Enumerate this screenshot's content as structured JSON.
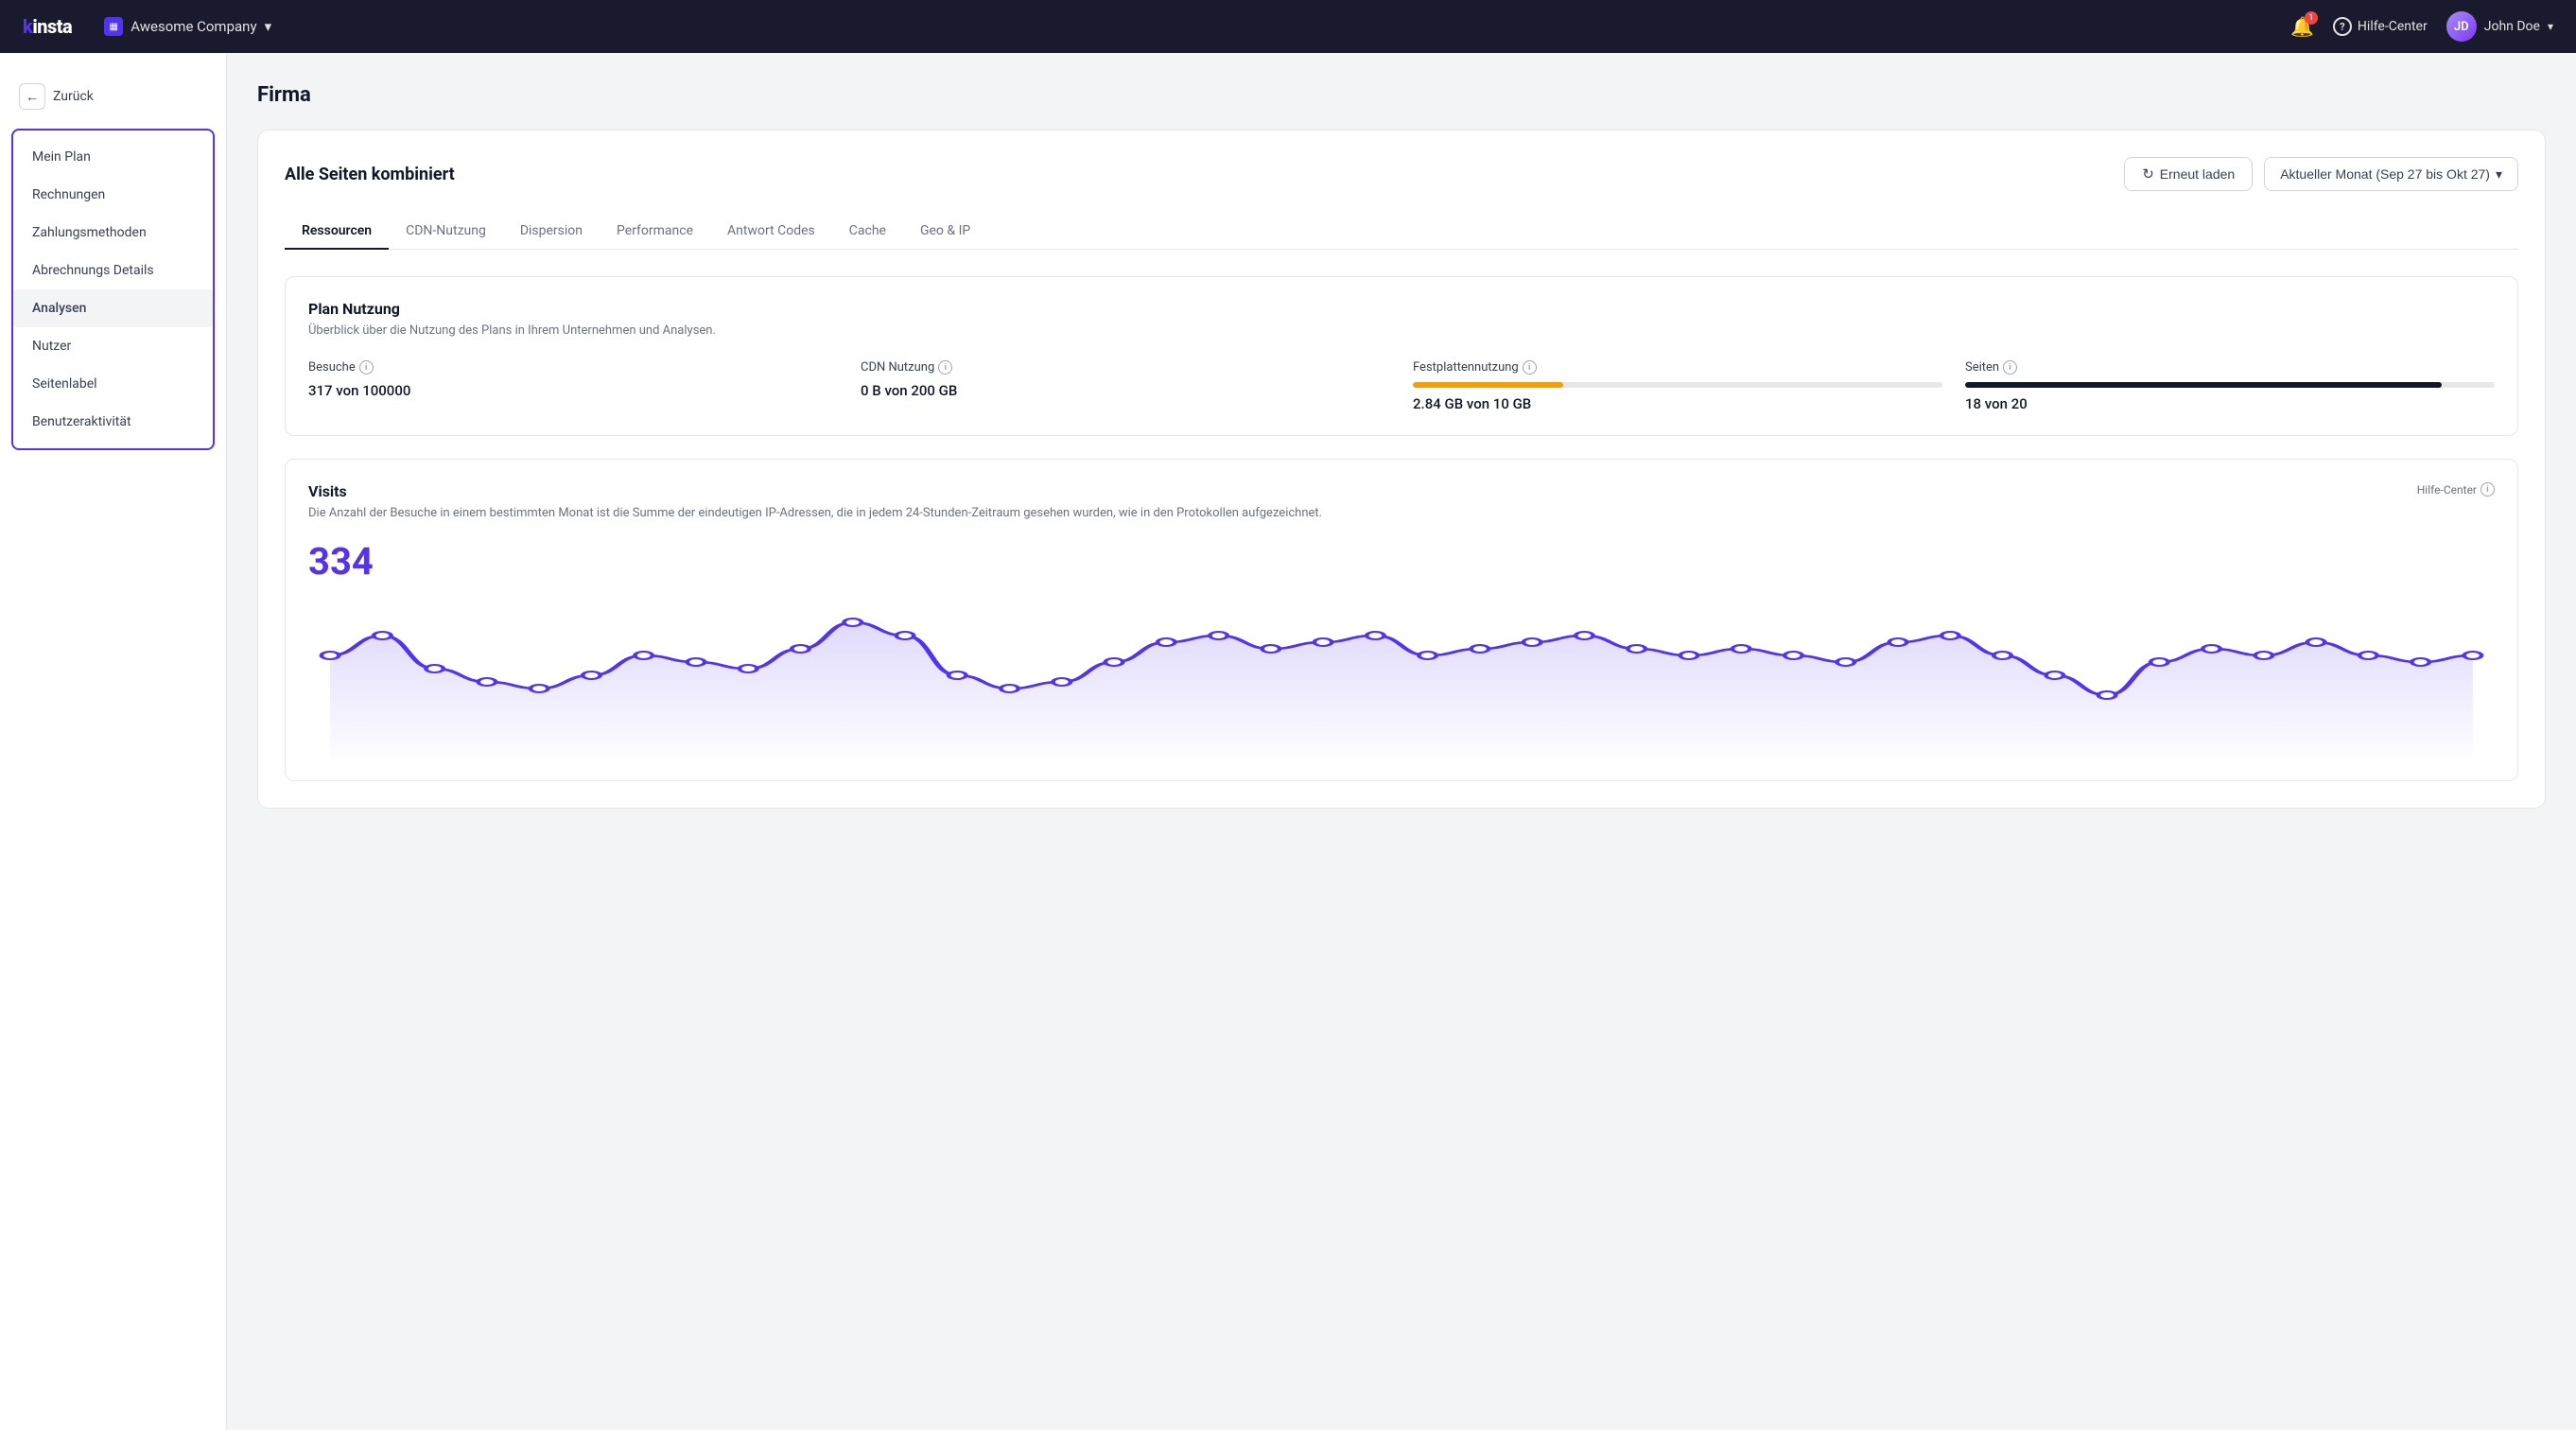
{
  "topnav": {
    "logo": "kinsta",
    "company": "Awesome Company",
    "company_icon": "▦",
    "bell_badge": "1",
    "help_label": "Hilfe-Center",
    "help_icon": "?",
    "username": "John Doe",
    "avatar_initials": "JD"
  },
  "sidebar": {
    "back_label": "Zurück",
    "items": [
      {
        "id": "mein-plan",
        "label": "Mein Plan",
        "active": false
      },
      {
        "id": "rechnungen",
        "label": "Rechnungen",
        "active": false
      },
      {
        "id": "zahlungsmethoden",
        "label": "Zahlungsmethoden",
        "active": false
      },
      {
        "id": "abrechnungs-details",
        "label": "Abrechnungs Details",
        "active": false
      },
      {
        "id": "analysen",
        "label": "Analysen",
        "active": true
      },
      {
        "id": "nutzer",
        "label": "Nutzer",
        "active": false
      },
      {
        "id": "seitenlabel",
        "label": "Seitenlabel",
        "active": false
      },
      {
        "id": "benutzeraktivitaet",
        "label": "Benutzeraktivität",
        "active": false
      }
    ]
  },
  "page": {
    "title": "Firma",
    "card_title": "Alle Seiten kombiniert",
    "reload_label": "Erneut laden",
    "period_label": "Aktueller Monat (Sep 27 bis Okt 27)"
  },
  "tabs": [
    {
      "id": "ressourcen",
      "label": "Ressourcen",
      "active": true
    },
    {
      "id": "cdn-nutzung",
      "label": "CDN-Nutzung",
      "active": false
    },
    {
      "id": "dispersion",
      "label": "Dispersion",
      "active": false
    },
    {
      "id": "performance",
      "label": "Performance",
      "active": false
    },
    {
      "id": "antwort-codes",
      "label": "Antwort Codes",
      "active": false
    },
    {
      "id": "cache",
      "label": "Cache",
      "active": false
    },
    {
      "id": "geo-ip",
      "label": "Geo & IP",
      "active": false
    }
  ],
  "plan_nutzung": {
    "title": "Plan Nutzung",
    "desc": "Überblick über die Nutzung des Plans in Ihrem Unternehmen und Analysen.",
    "metrics": [
      {
        "id": "besuche",
        "label": "Besuche",
        "value": "317 von 100000",
        "has_progress": false,
        "progress_pct": 0.317,
        "progress_type": ""
      },
      {
        "id": "cdn-nutzung",
        "label": "CDN Nutzung",
        "value": "0 B von 200 GB",
        "has_progress": false,
        "progress_pct": 0,
        "progress_type": ""
      },
      {
        "id": "festplattennutzung",
        "label": "Festplattennutzung",
        "value": "2.84 GB von 10 GB",
        "has_progress": true,
        "progress_pct": 28.4,
        "progress_type": "orange"
      },
      {
        "id": "seiten",
        "label": "Seiten",
        "value": "18 von 20",
        "has_progress": true,
        "progress_pct": 90,
        "progress_type": "dark"
      }
    ]
  },
  "visits": {
    "title": "Visits",
    "help_label": "Hilfe-Center",
    "desc": "Die Anzahl der Besuche in einem bestimmten Monat ist die Summe der eindeutigen IP-Adressen, die in jedem 24-Stunden-Zeitraum gesehen wurden, wie in den Protokollen aufgezeichnet.",
    "count": "334",
    "chart_color": "#5333ed",
    "chart_points": [
      0.7,
      0.85,
      0.6,
      0.5,
      0.45,
      0.55,
      0.7,
      0.65,
      0.6,
      0.75,
      0.95,
      0.85,
      0.55,
      0.45,
      0.5,
      0.65,
      0.8,
      0.85,
      0.75,
      0.8,
      0.85,
      0.7,
      0.75,
      0.8,
      0.85,
      0.75,
      0.7,
      0.75,
      0.7,
      0.65,
      0.8,
      0.85,
      0.7,
      0.55,
      0.4,
      0.65,
      0.75,
      0.7,
      0.8,
      0.7,
      0.65,
      0.7
    ]
  }
}
